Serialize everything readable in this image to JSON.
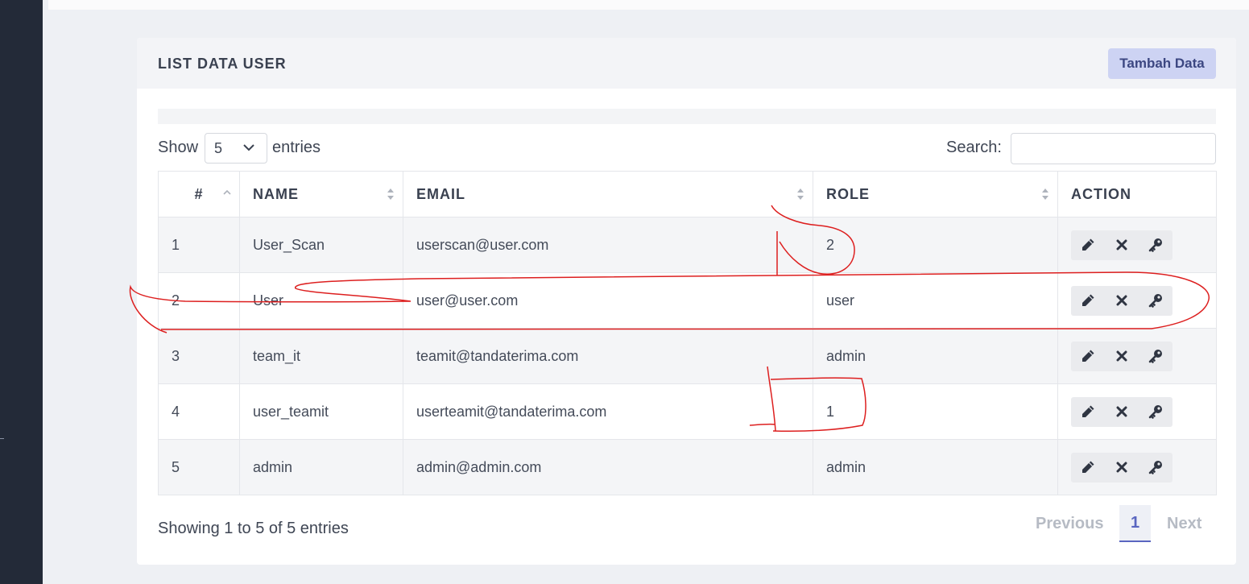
{
  "card": {
    "title": "LIST DATA USER",
    "add_button": "Tambah Data"
  },
  "controls": {
    "show_label": "Show",
    "page_length": "5",
    "entries_label": "entries",
    "search_label": "Search:",
    "search_value": ""
  },
  "table": {
    "columns": [
      "#",
      "NAME",
      "EMAIL",
      "ROLE",
      "ACTION"
    ],
    "rows": [
      {
        "no": "1",
        "name": "User_Scan",
        "email": "userscan@user.com",
        "role": "2"
      },
      {
        "no": "2",
        "name": "User",
        "email": "user@user.com",
        "role": "user"
      },
      {
        "no": "3",
        "name": "team_it",
        "email": "teamit@tandaterima.com",
        "role": "admin"
      },
      {
        "no": "4",
        "name": "user_teamit",
        "email": "userteamit@tandaterima.com",
        "role": "1"
      },
      {
        "no": "5",
        "name": "admin",
        "email": "admin@admin.com",
        "role": "admin"
      }
    ],
    "row_action_icons": [
      "pencil-icon",
      "close-icon",
      "key-icon"
    ]
  },
  "footer": {
    "info": "Showing 1 to 5 of 5 entries",
    "previous": "Previous",
    "current_page": "1",
    "next": "Next"
  },
  "colors": {
    "sidebar": "#232a38",
    "accent": "#5a66c0",
    "annotation": "#dd1f1f"
  }
}
